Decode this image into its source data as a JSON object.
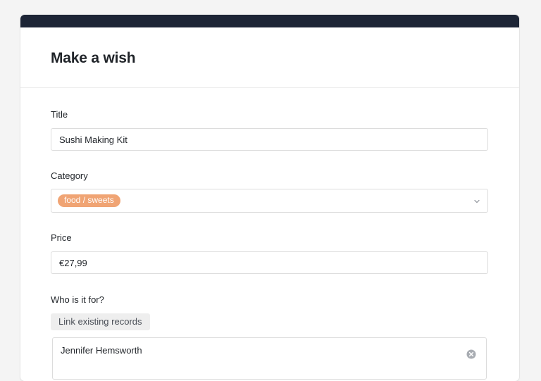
{
  "form": {
    "title": "Make a wish",
    "fields": {
      "title": {
        "label": "Title",
        "value": "Sushi Making Kit"
      },
      "category": {
        "label": "Category",
        "selected_tag": "food / sweets",
        "tag_color": "#f0a474"
      },
      "price": {
        "label": "Price",
        "value": "€27,99"
      },
      "who_for": {
        "label": "Who is it for?",
        "link_button": "Link existing records",
        "records": [
          {
            "name": "Jennifer Hemsworth"
          }
        ]
      }
    }
  },
  "icons": {
    "category_toggle": "chevron-down-icon",
    "record_remove": "close-circle-icon"
  },
  "colors": {
    "topbar": "#1d2536",
    "accent_tag": "#f0a474"
  }
}
